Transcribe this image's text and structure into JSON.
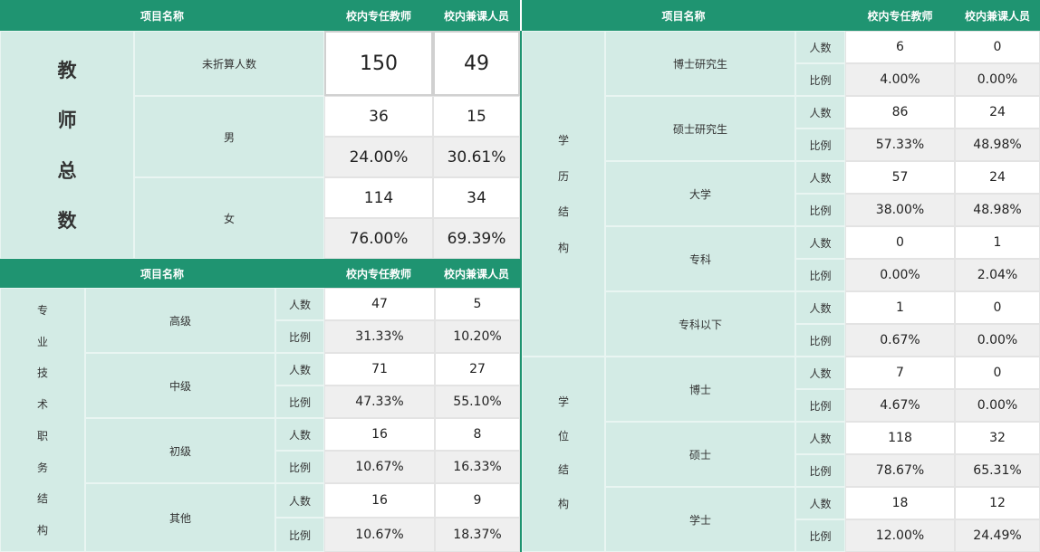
{
  "header": {
    "item_name": "项目名称",
    "full_time": "校内专任教师",
    "part_time": "校内兼课人员"
  },
  "total": {
    "title_chars": [
      "教",
      "师",
      "总",
      "数"
    ],
    "unconverted_label": "未折算人数",
    "unconverted": {
      "full": "150",
      "part": "49"
    },
    "male_label": "男",
    "male": {
      "full": "36",
      "part": "15",
      "full_pct": "24.00%",
      "part_pct": "30.61%"
    },
    "female_label": "女",
    "female": {
      "full": "114",
      "part": "34",
      "full_pct": "76.00%",
      "part_pct": "69.39%"
    }
  },
  "labels": {
    "count": "人数",
    "ratio": "比例"
  },
  "title_section": {
    "title_chars": [
      "专",
      "业",
      "技",
      "术",
      "职",
      "务",
      "结",
      "构"
    ],
    "rows": [
      {
        "label": "高级",
        "full": "47",
        "part": "5",
        "full_pct": "31.33%",
        "part_pct": "10.20%"
      },
      {
        "label": "中级",
        "full": "71",
        "part": "27",
        "full_pct": "47.33%",
        "part_pct": "55.10%"
      },
      {
        "label": "初级",
        "full": "16",
        "part": "8",
        "full_pct": "10.67%",
        "part_pct": "16.33%"
      },
      {
        "label": "其他",
        "full": "16",
        "part": "9",
        "full_pct": "10.67%",
        "part_pct": "18.37%"
      }
    ]
  },
  "education": {
    "title_chars": [
      "学",
      "历",
      "结",
      "构"
    ],
    "rows": [
      {
        "label": "博士研究生",
        "full": "6",
        "part": "0",
        "full_pct": "4.00%",
        "part_pct": "0.00%"
      },
      {
        "label": "硕士研究生",
        "full": "86",
        "part": "24",
        "full_pct": "57.33%",
        "part_pct": "48.98%"
      },
      {
        "label": "大学",
        "full": "57",
        "part": "24",
        "full_pct": "38.00%",
        "part_pct": "48.98%"
      },
      {
        "label": "专科",
        "full": "0",
        "part": "1",
        "full_pct": "0.00%",
        "part_pct": "2.04%"
      },
      {
        "label": "专科以下",
        "full": "1",
        "part": "0",
        "full_pct": "0.67%",
        "part_pct": "0.00%"
      }
    ]
  },
  "degree": {
    "title_chars": [
      "学",
      "位",
      "结",
      "构"
    ],
    "rows": [
      {
        "label": "博士",
        "full": "7",
        "part": "0",
        "full_pct": "4.67%",
        "part_pct": "0.00%"
      },
      {
        "label": "硕士",
        "full": "118",
        "part": "32",
        "full_pct": "78.67%",
        "part_pct": "65.31%"
      },
      {
        "label": "学士",
        "full": "18",
        "part": "12",
        "full_pct": "12.00%",
        "part_pct": "24.49%"
      }
    ]
  }
}
